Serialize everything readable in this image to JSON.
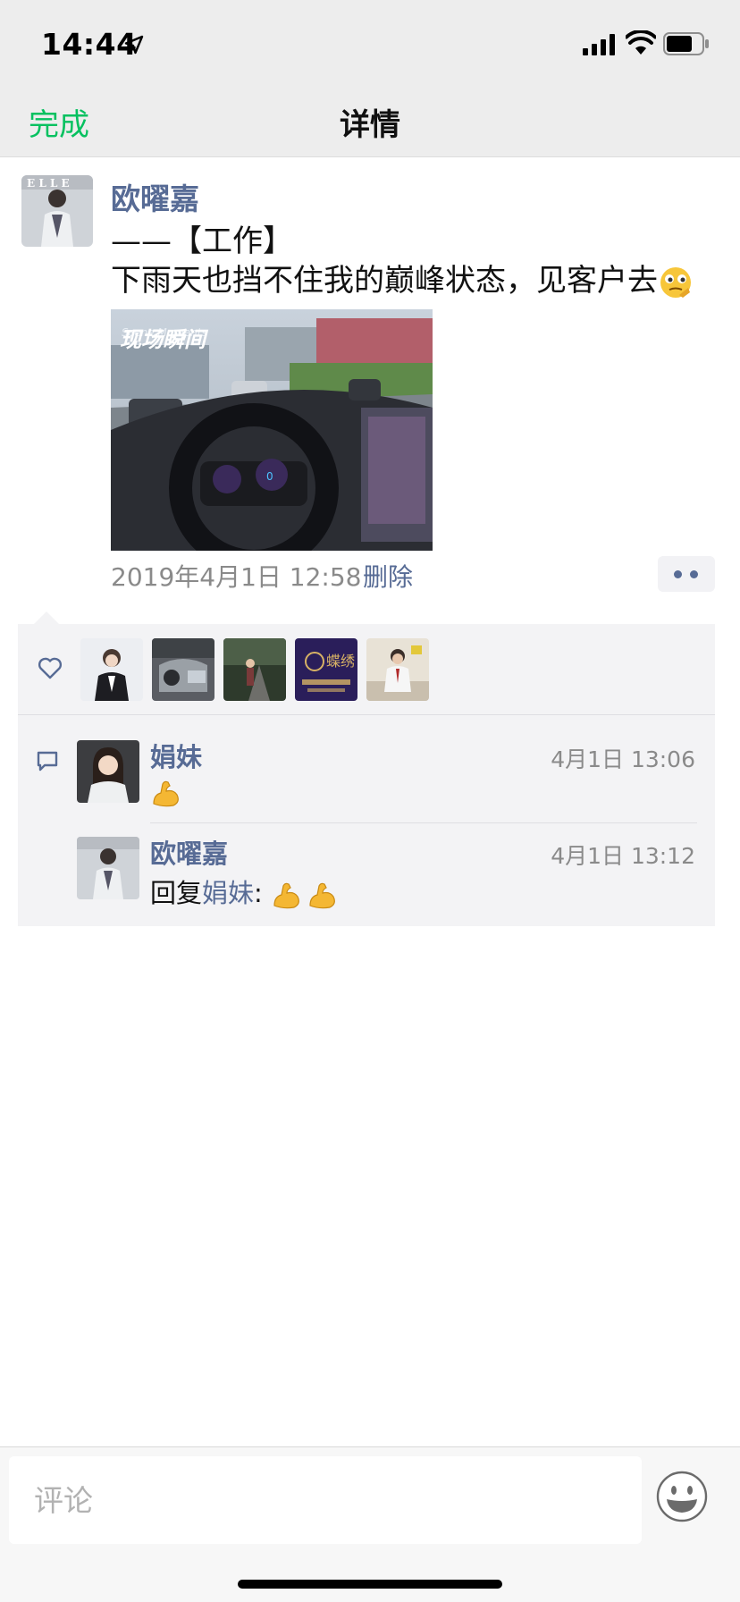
{
  "status_bar": {
    "time": "14:44",
    "icons": [
      "location-arrow-icon",
      "signal-icon",
      "wifi-icon",
      "battery-icon"
    ]
  },
  "nav": {
    "done_label": "完成",
    "title": "详情"
  },
  "post": {
    "author": "欧曜嘉",
    "text_line1": "——【工作】",
    "text_line2": "下雨天也挡不住我的巅峰状态，见客户去",
    "text_emoji": "thinking-face-emoji",
    "photo_caption_overlay": "Scene Moments 现场瞬间",
    "timestamp": "2019年4月1日 12:58",
    "delete_label": "删除"
  },
  "likes": {
    "icon": "heart-icon",
    "avatars": [
      "avatar-woman-portrait",
      "avatar-car-interior",
      "avatar-woman-street",
      "avatar-brand-logo",
      "avatar-man-suit"
    ],
    "brand_avatar_text": "蝶绣"
  },
  "comments": [
    {
      "name": "娟妹",
      "time": "4月1日 13:06",
      "emoji": "flexed-biceps-emoji"
    },
    {
      "name": "欧曜嘉",
      "time": "4月1日 13:12",
      "reply_prefix": "回复",
      "reply_to": "娟妹",
      "reply_colon": ":",
      "emojis": [
        "flexed-biceps-emoji",
        "flexed-biceps-emoji"
      ]
    }
  ],
  "input": {
    "placeholder": "评论"
  },
  "colors": {
    "wechat_green": "#07c160",
    "link_blue": "#576b95",
    "panel_bg": "#f3f3f5",
    "header_bg": "#ededed"
  }
}
